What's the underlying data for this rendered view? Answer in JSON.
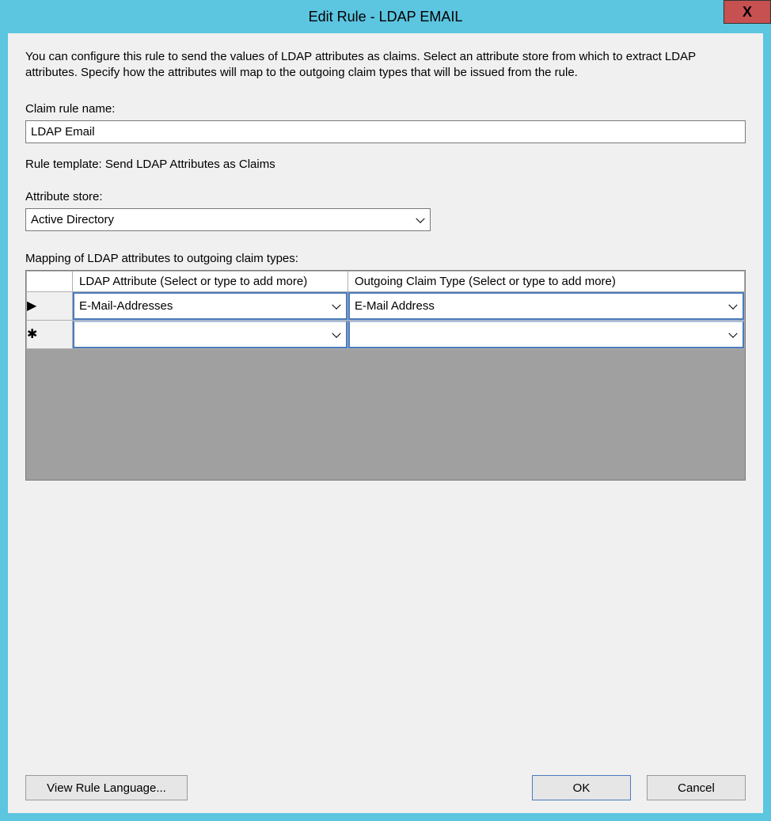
{
  "window": {
    "title": "Edit Rule - LDAP EMAIL",
    "close_glyph": "X"
  },
  "description": "You can configure this rule to send the values of LDAP attributes as claims. Select an attribute store from which to extract LDAP attributes. Specify how the attributes will map to the outgoing claim types that will be issued from the rule.",
  "labels": {
    "claim_rule_name": "Claim rule name:",
    "rule_template_prefix": "Rule template: ",
    "rule_template_value": "Send LDAP Attributes as Claims",
    "attribute_store": "Attribute store:",
    "mapping": "Mapping of LDAP attributes to outgoing claim types:"
  },
  "fields": {
    "claim_rule_name_value": "LDAP Email",
    "attribute_store_value": "Active Directory"
  },
  "grid": {
    "header_ldap": "LDAP Attribute (Select or type to add more)",
    "header_claim": "Outgoing Claim Type (Select or type to add more)",
    "rows": [
      {
        "indicator": "▶",
        "ldap": "E-Mail-Addresses",
        "claim": "E-Mail Address"
      },
      {
        "indicator": "✱",
        "ldap": "",
        "claim": ""
      }
    ]
  },
  "buttons": {
    "view_rule_language": "View Rule Language...",
    "ok": "OK",
    "cancel": "Cancel"
  }
}
